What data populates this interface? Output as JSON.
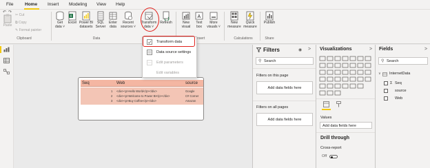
{
  "menu": {
    "items": [
      "File",
      "Home",
      "Insert",
      "Modeling",
      "View",
      "Help"
    ],
    "active": "Home"
  },
  "ribbon": {
    "clipboard": {
      "paste": "Paste",
      "cut": "Cut",
      "copy": "Copy",
      "format_painter": "Format painter",
      "group_label": "Clipboard"
    },
    "data": {
      "get_data": [
        "Get",
        "data ˅"
      ],
      "excel": "Excel",
      "powerbi_datasets": [
        "Power BI",
        "datasets"
      ],
      "sql_server": [
        "SQL",
        "Server"
      ],
      "enter_data": [
        "Enter",
        "data"
      ],
      "recent_sources": [
        "Recent",
        "sources ˅"
      ],
      "transform_data": [
        "Transform",
        "data ˅"
      ],
      "refresh": "Refresh",
      "group_label": "Data"
    },
    "insert": {
      "new_visual": [
        "New",
        "visual"
      ],
      "text_box": [
        "Text",
        "box"
      ],
      "more_visuals": [
        "More",
        "visuals ˅"
      ],
      "group_label": "Insert"
    },
    "calculations": {
      "new_measure": [
        "New",
        "measure"
      ],
      "quick_measure": [
        "Quick",
        "measure"
      ],
      "group_label": "Calculations"
    },
    "share": {
      "publish": "Publish",
      "group_label": "Share"
    }
  },
  "dropdown": {
    "items": [
      {
        "label": "Transform data",
        "enabled": true
      },
      {
        "label": "Data source settings",
        "enabled": true
      },
      {
        "label": "Edit parameters",
        "enabled": false
      },
      {
        "label": "Edit variables",
        "enabled": false
      }
    ]
  },
  "table_visual": {
    "columns": [
      "Seq",
      "Web",
      "source"
    ],
    "rows": [
      {
        "seq": "1",
        "web": "<div><p>Hello World</p></div>",
        "source": "Google"
      },
      {
        "seq": "2",
        "web": "<div><p>Welcome to Power BI</p></div>",
        "source": "C# Corner"
      },
      {
        "seq": "3",
        "web": "<div><p>Buy Coffee</p></div>",
        "source": "Amazon"
      }
    ]
  },
  "filters_pane": {
    "title": "Filters",
    "search_placeholder": "Search",
    "on_this_page": "Filters on this page",
    "on_all_pages": "Filters on all pages",
    "add_fields_1": "Add data fields here",
    "add_fields_2": "Add data fields here"
  },
  "viz_pane": {
    "title": "Visualizations",
    "values_label": "Values",
    "add_fields": "Add data fields here",
    "drill_through": "Drill through",
    "cross_report": "Cross-report",
    "toggle_off": "Off"
  },
  "fields_pane": {
    "title": "Fields",
    "search_placeholder": "Search",
    "table_name": "InternetData",
    "fields": [
      {
        "label": "Seq",
        "sigma": true
      },
      {
        "label": "source",
        "sigma": false
      },
      {
        "label": "Web",
        "sigma": false
      }
    ]
  },
  "colors": {
    "accent": "#f2c811",
    "annotation": "#e0201b",
    "table_header": "#f4b6a2",
    "table_body": "#f3c5b5"
  },
  "icons": [
    "undo-icon",
    "redo-icon",
    "paste-icon",
    "cut-icon",
    "copy-icon",
    "format-painter-icon",
    "table-icon",
    "report-icon",
    "model-icon",
    "eye-icon",
    "search-icon",
    "chevron-right-icon"
  ]
}
